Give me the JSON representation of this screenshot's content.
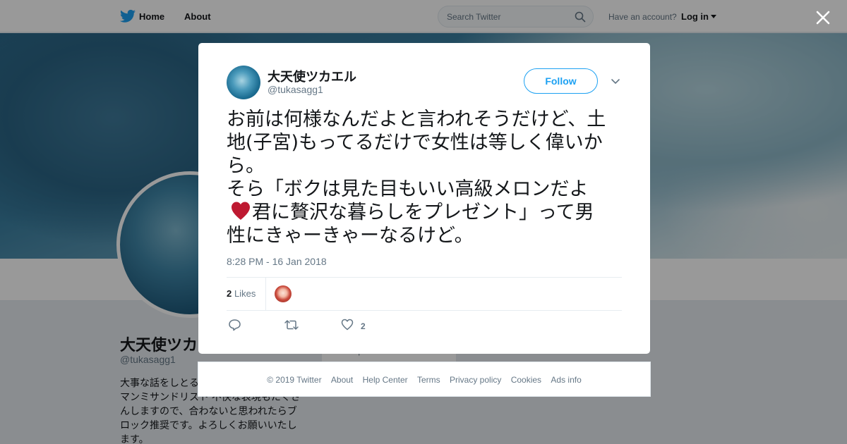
{
  "nav": {
    "home_label": "Home",
    "about_label": "About",
    "search_placeholder": "Search Twitter",
    "have_account": "Have an account?",
    "login_label": "Log in"
  },
  "profile": {
    "name": "大天使ツカエル",
    "handle": "@tukasagg1",
    "bio": "大事な話をしとる\nマンミサンドリスト 不快な表現もたくさ\nんしますので、合わないと思われたらブ\nロック推奨です。よろしくお願いいたし\nます。",
    "side_card_text": "Help Center    Terms"
  },
  "tweet": {
    "author_name": "大天使ツカエル",
    "author_handle": "@tukasagg1",
    "follow_label": "Follow",
    "text_line1": "お前は何様なんだよと言われそうだけど、土\n地(子宮)もってるだけで女性は等しく偉いか\nら。\nそら「ボクは見た目もいい高級メロンだよ",
    "text_line2": "君に贅沢な暮らしをプレゼント」って男",
    "text_line3": "性にきゃーきゃーなるけど。",
    "timestamp": "8:28 PM - 16 Jan 2018",
    "likes_count": "2",
    "likes_label": "Likes",
    "like_action_count": "2"
  },
  "footer": {
    "links": [
      "© 2019 Twitter",
      "About",
      "Help Center",
      "Terms",
      "Privacy policy",
      "Cookies",
      "Ads info"
    ]
  },
  "colors": {
    "accent": "#1da1f2",
    "muted_text": "#657786",
    "heart": "#be1931"
  },
  "icons": [
    "twitter-logo-icon",
    "search-icon",
    "close-icon",
    "chevron-down-icon",
    "heart-emoji-icon",
    "reply-icon",
    "retweet-icon",
    "like-icon"
  ]
}
